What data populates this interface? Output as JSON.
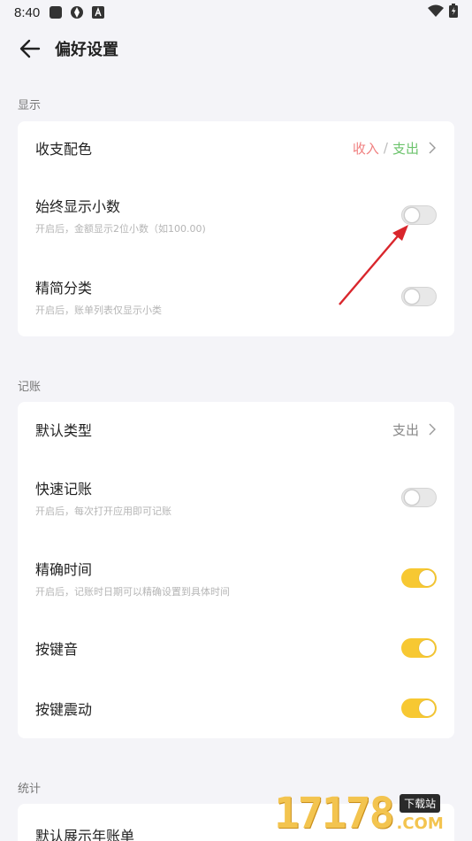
{
  "status_bar": {
    "time": "8:40"
  },
  "app_bar": {
    "title": "偏好设置"
  },
  "sections": {
    "display": {
      "label": "显示",
      "color_scheme": {
        "title": "收支配色",
        "income": "收入",
        "sep": "/",
        "expense": "支出",
        "income_color": "#f08080",
        "expense_color": "#6cc36c"
      },
      "always_decimal": {
        "title": "始终显示小数",
        "sub": "开启后，金额显示2位小数（如100.00)",
        "on": false
      },
      "simple_category": {
        "title": "精简分类",
        "sub": "开启后，账单列表仅显示小类",
        "on": false
      }
    },
    "bookkeeping": {
      "label": "记账",
      "default_type": {
        "title": "默认类型",
        "value": "支出"
      },
      "quick_record": {
        "title": "快速记账",
        "sub": "开启后，每次打开应用即可记账",
        "on": false
      },
      "precise_time": {
        "title": "精确时间",
        "sub": "开启后，记账时日期可以精确设置到具体时间",
        "on": true
      },
      "key_sound": {
        "title": "按键音",
        "on": true
      },
      "key_vibrate": {
        "title": "按键震动",
        "on": true
      }
    },
    "stats": {
      "label": "统计",
      "default_year_bill": {
        "title": "默认展示年账单"
      }
    }
  },
  "watermark": {
    "number": "17178",
    "badge": "下载站",
    "com": ".COM"
  },
  "colors": {
    "accent": "#f7c832",
    "annotation": "#d9262c"
  }
}
